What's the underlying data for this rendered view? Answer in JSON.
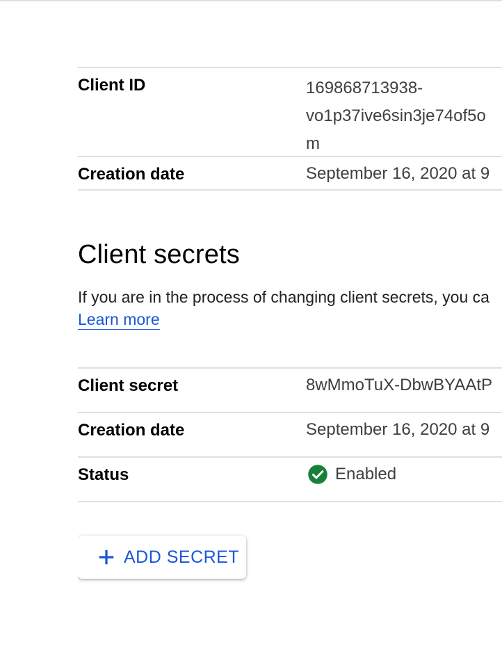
{
  "client_info": {
    "rows": [
      {
        "key": "Client ID",
        "value_lines": [
          "169868713938-",
          "vo1p37ive6sin3je74of5o",
          "m"
        ]
      },
      {
        "key": "Creation date",
        "value_lines": [
          "September 16, 2020 at 9"
        ]
      }
    ]
  },
  "client_secrets": {
    "title": "Client secrets",
    "description": "If you are in the process of changing client secrets, you ca",
    "learn_more": "Learn more",
    "rows": {
      "client_secret": {
        "key": "Client secret",
        "value": "8wMmoTuX-DbwBYAAtP"
      },
      "creation_date": {
        "key": "Creation date",
        "value": "September 16, 2020 at 9"
      },
      "status": {
        "key": "Status",
        "value": "Enabled"
      }
    },
    "status_icon": "check-circle-icon",
    "status_color": "#188038",
    "add_button_label": "ADD SECRET",
    "add_button_icon": "plus-icon"
  },
  "colors": {
    "link": "#1a56d6",
    "divider": "#e0e0e0"
  }
}
